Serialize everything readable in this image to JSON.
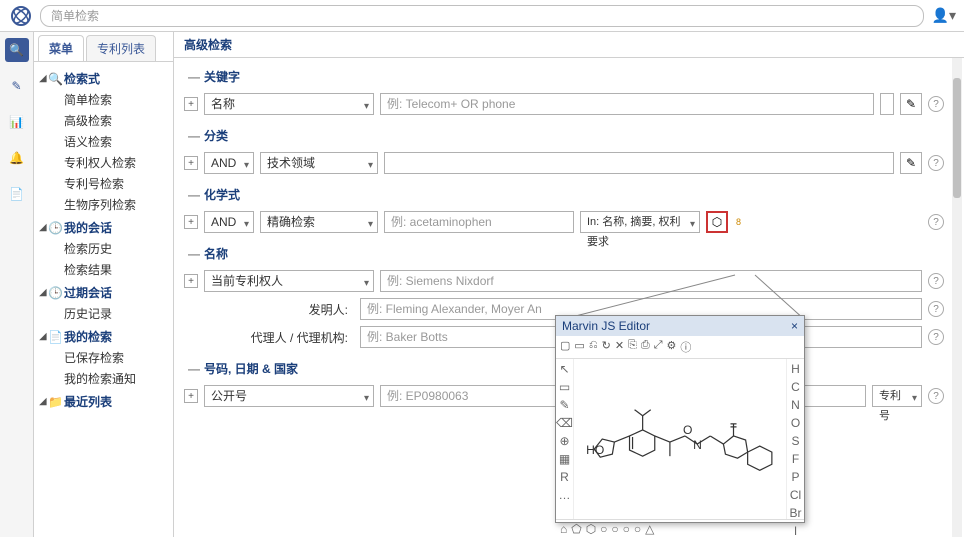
{
  "topbar": {
    "search_placeholder": "简单检索"
  },
  "sidebar": {
    "tabs": [
      "菜单",
      "专利列表"
    ],
    "groups": [
      {
        "title": "检索式",
        "icon": "🔍",
        "items": [
          "简单检索",
          "高级检索",
          "语义检索",
          "专利权人检索",
          "专利号检索",
          "生物序列检索"
        ]
      },
      {
        "title": "我的会话",
        "icon": "🕒",
        "items": [
          "检索历史",
          "检索结果"
        ]
      },
      {
        "title": "过期会话",
        "icon": "🕒",
        "items": [
          "历史记录"
        ]
      },
      {
        "title": "我的检索",
        "icon": "📄",
        "items": [
          "已保存检索",
          "我的检索通知"
        ]
      },
      {
        "title": "最近列表",
        "icon": "📁",
        "items": []
      }
    ]
  },
  "content": {
    "title": "高级检索",
    "sections": {
      "keyword": {
        "title": "关键字",
        "field": "名称",
        "placeholder": "例: Telecom+ OR phone"
      },
      "classify": {
        "title": "分类",
        "op": "AND",
        "field": "技术领域"
      },
      "chem": {
        "title": "化学式",
        "op": "AND",
        "field": "精确检索",
        "placeholder": "例: acetaminophen",
        "in": "In: 名称, 摘要, 权利要求",
        "badge": "8"
      },
      "names": {
        "title": "名称",
        "owner_field": "当前专利权人",
        "owner_ph": "例: Siemens Nixdorf",
        "inventor_lbl": "发明人:",
        "inventor_ph": "例: Fleming Alexander, Moyer An",
        "agent_lbl": "代理人 / 代理机构:",
        "agent_ph": "例: Baker Botts"
      },
      "ids": {
        "title": "号码, 日期 & 国家",
        "field": "公开号",
        "placeholder": "例: EP0980063",
        "btn": "专利号"
      }
    }
  },
  "popup": {
    "title": "Marvin JS Editor",
    "toolbar": [
      "▢",
      "▭",
      "⎌",
      "↻",
      "✕",
      "⎘",
      "⎙",
      "⤢",
      "⚙",
      "ⓘ"
    ],
    "left": [
      "↖",
      "▭",
      "✎",
      "⌫",
      "⊕",
      "▦",
      "R",
      "…"
    ],
    "right": [
      "H",
      "C",
      "N",
      "O",
      "S",
      "F",
      "P",
      "Cl",
      "Br",
      "I"
    ],
    "bottom": [
      "⌂",
      "⬠",
      "⬡",
      "○",
      "○",
      "○",
      "○",
      "△"
    ]
  }
}
